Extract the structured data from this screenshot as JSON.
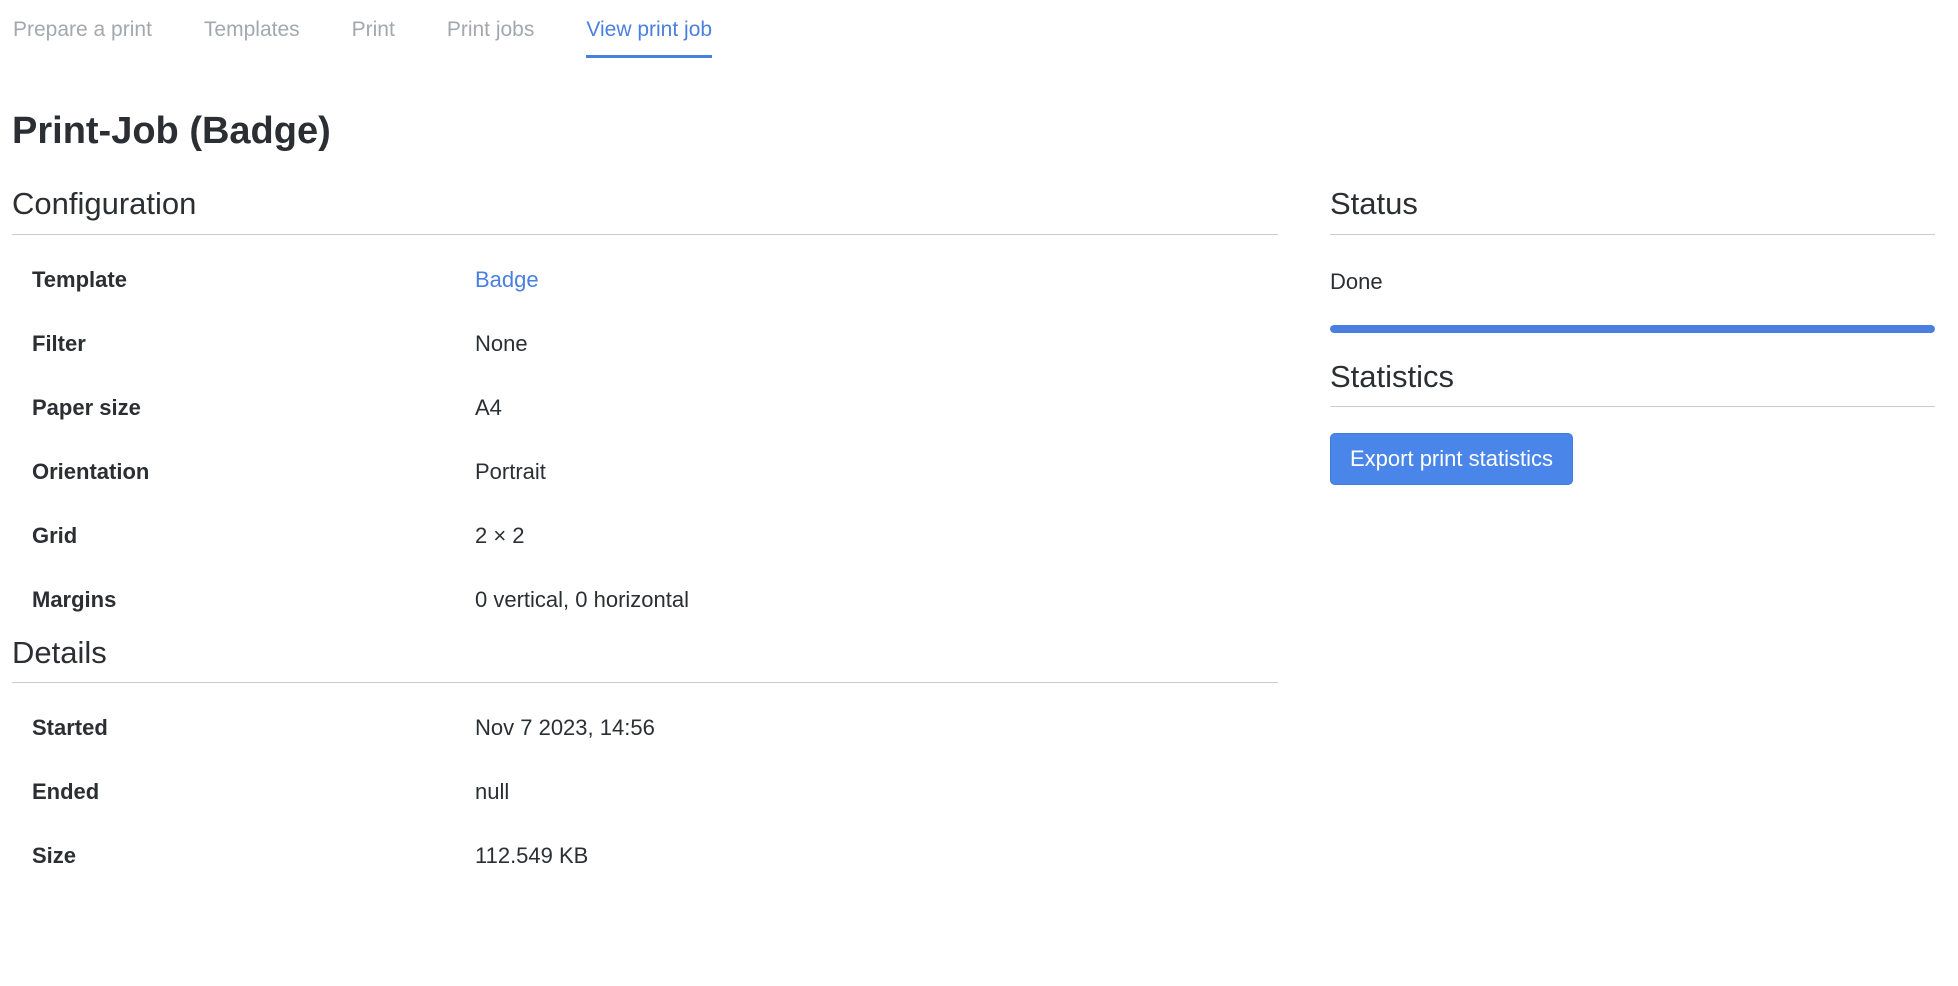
{
  "tabs": [
    {
      "label": "Prepare a print",
      "active": false
    },
    {
      "label": "Templates",
      "active": false
    },
    {
      "label": "Print",
      "active": false
    },
    {
      "label": "Print jobs",
      "active": false
    },
    {
      "label": "View print job",
      "active": true
    }
  ],
  "page_title": "Print-Job (Badge)",
  "configuration": {
    "title": "Configuration",
    "rows": [
      {
        "key": "Template",
        "value": "Badge",
        "link": true
      },
      {
        "key": "Filter",
        "value": "None"
      },
      {
        "key": "Paper size",
        "value": "A4"
      },
      {
        "key": "Orientation",
        "value": "Portrait"
      },
      {
        "key": "Grid",
        "value": "2 × 2"
      },
      {
        "key": "Margins",
        "value": "0 vertical, 0 horizontal"
      }
    ]
  },
  "details": {
    "title": "Details",
    "rows": [
      {
        "key": "Started",
        "value": "Nov 7 2023, 14:56"
      },
      {
        "key": "Ended",
        "value": "null"
      },
      {
        "key": "Size",
        "value": "112.549 KB"
      }
    ]
  },
  "status": {
    "title": "Status",
    "text": "Done",
    "progress": 1.0
  },
  "statistics": {
    "title": "Statistics",
    "export_button": "Export print statistics"
  },
  "colors": {
    "accent": "#4a7fe0",
    "button": "#4a86ea",
    "muted_tab": "#a3a8ae",
    "text": "#2b2f33"
  }
}
